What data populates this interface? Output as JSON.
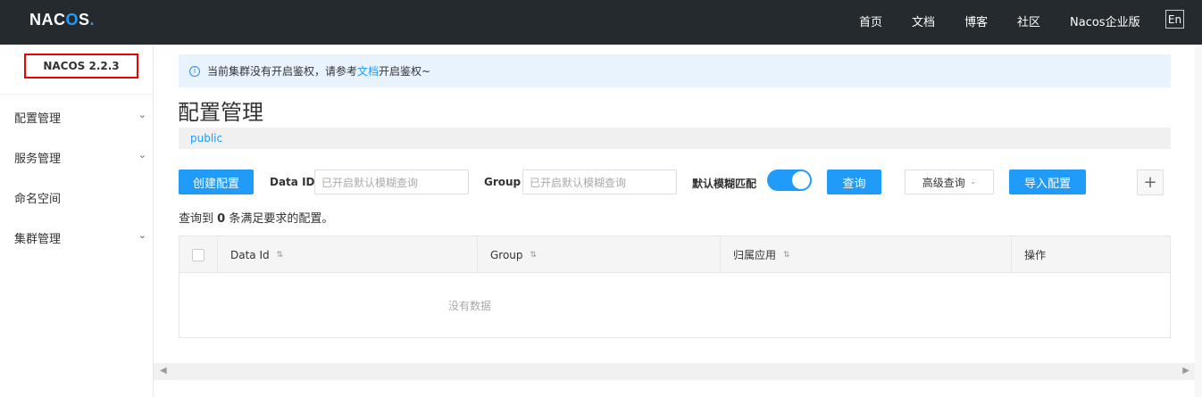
{
  "topbar": {
    "logo_prefix": "NAC",
    "logo_o": "O",
    "logo_suffix": "S",
    "logo_dot": ".",
    "nav": [
      "首页",
      "文档",
      "博客",
      "社区",
      "Nacos企业版"
    ],
    "lang": "En"
  },
  "sidebar": {
    "version": "NACOS 2.2.3",
    "items": [
      {
        "label": "配置管理",
        "chevron": "⌄"
      },
      {
        "label": "服务管理",
        "chevron": "⌄"
      },
      {
        "label": "命名空间",
        "chevron": ""
      },
      {
        "label": "集群管理",
        "chevron": "⌄"
      }
    ]
  },
  "alert": {
    "icon": "i",
    "prefix": "当前集群没有开启鉴权，请参考",
    "link": "文档",
    "suffix": "开启鉴权~"
  },
  "page_title": "配置管理",
  "namespace": "public",
  "toolbar": {
    "create_label": "创建配置",
    "dataid_label": "Data ID",
    "dataid_placeholder": "已开启默认模糊查询",
    "group_label": "Group",
    "group_placeholder": "已开启默认模糊查询",
    "fuzzy_label": "默认模糊匹配",
    "fuzzy_enabled": true,
    "query_label": "查询",
    "advanced_label": "高级查询",
    "advanced_chevron": "⌄",
    "import_label": "导入配置",
    "plus": "+"
  },
  "summary": {
    "prefix": "查询到",
    "count": "0",
    "suffix": "条满足要求的配置。"
  },
  "table": {
    "columns": [
      {
        "label": "Data Id",
        "sort": "⇅"
      },
      {
        "label": "Group",
        "sort": "⇅"
      },
      {
        "label": "归属应用",
        "sort": "⇅"
      },
      {
        "label": "操作",
        "sort": ""
      }
    ],
    "empty_text": "没有数据"
  },
  "scrollbar": {
    "left": "◀",
    "right": "▶"
  }
}
